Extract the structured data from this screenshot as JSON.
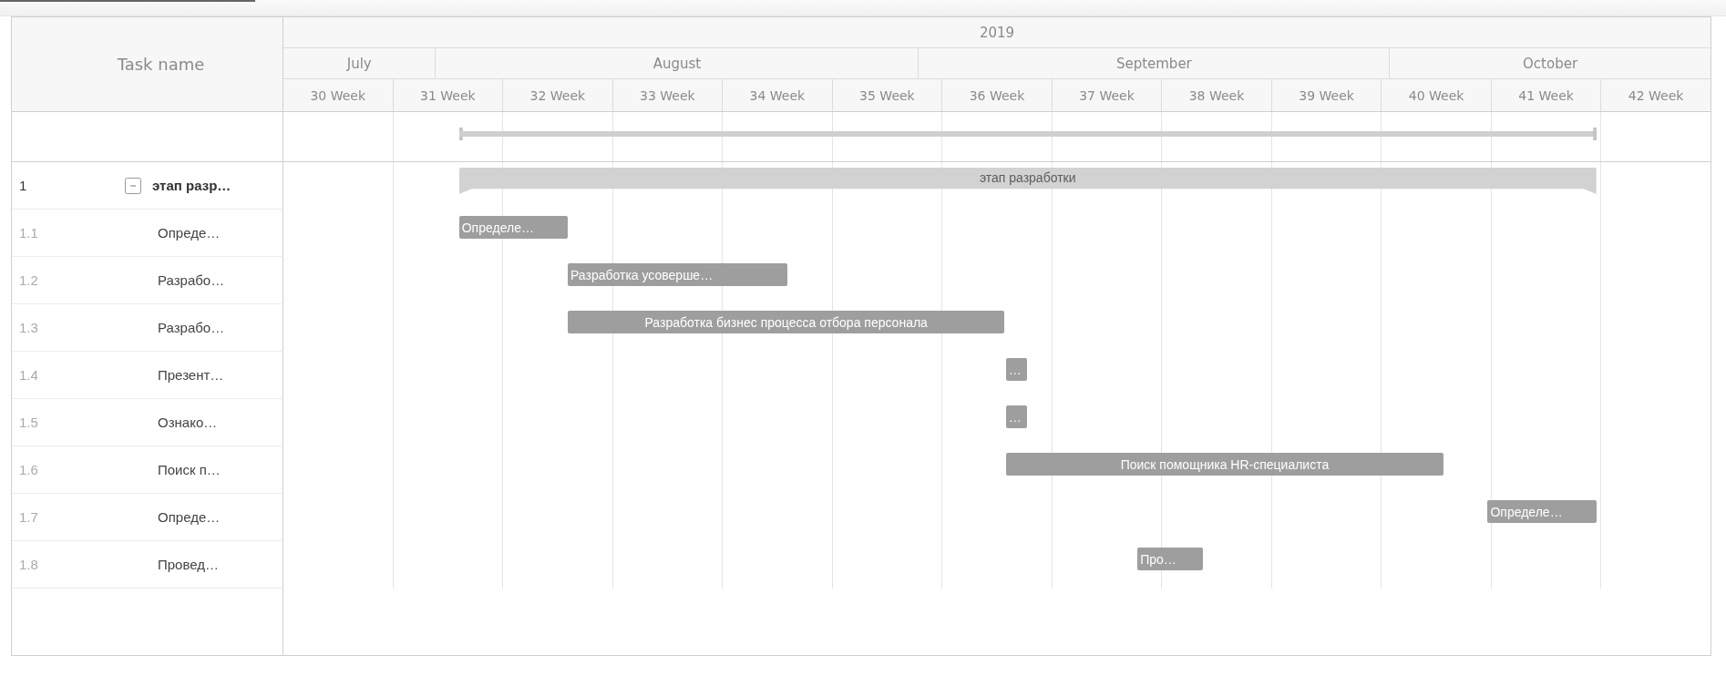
{
  "task_list": {
    "header": "Task name"
  },
  "timeline": {
    "year": "2019",
    "months": [
      "July",
      "August",
      "September",
      "October"
    ],
    "weeks": [
      "30 Week",
      "31 Week",
      "32 Week",
      "33 Week",
      "34 Week",
      "35 Week",
      "36 Week",
      "37 Week",
      "38 Week",
      "39 Week",
      "40 Week",
      "41 Week",
      "42 Week"
    ]
  },
  "tasks": [
    {
      "number": "1",
      "name": "этап разр…",
      "bar_label": "этап разработки",
      "expanded": true,
      "children": [
        {
          "number": "1.1",
          "name": "Опреде…",
          "bar_label": "Определе…"
        },
        {
          "number": "1.2",
          "name": "Разрабо…",
          "bar_label": "Разработка усоверше…"
        },
        {
          "number": "1.3",
          "name": "Разрабо…",
          "bar_label": "Разработка бизнес процесса отбора персонала"
        },
        {
          "number": "1.4",
          "name": "Презент…",
          "bar_label": "…"
        },
        {
          "number": "1.5",
          "name": "Ознако…",
          "bar_label": "…"
        },
        {
          "number": "1.6",
          "name": "Поиск п…",
          "bar_label": "Поиск помощника HR-специалиста"
        },
        {
          "number": "1.7",
          "name": "Опреде…",
          "bar_label": "Определе…"
        },
        {
          "number": "1.8",
          "name": "Провед…",
          "bar_label": "Про…"
        }
      ]
    }
  ]
}
